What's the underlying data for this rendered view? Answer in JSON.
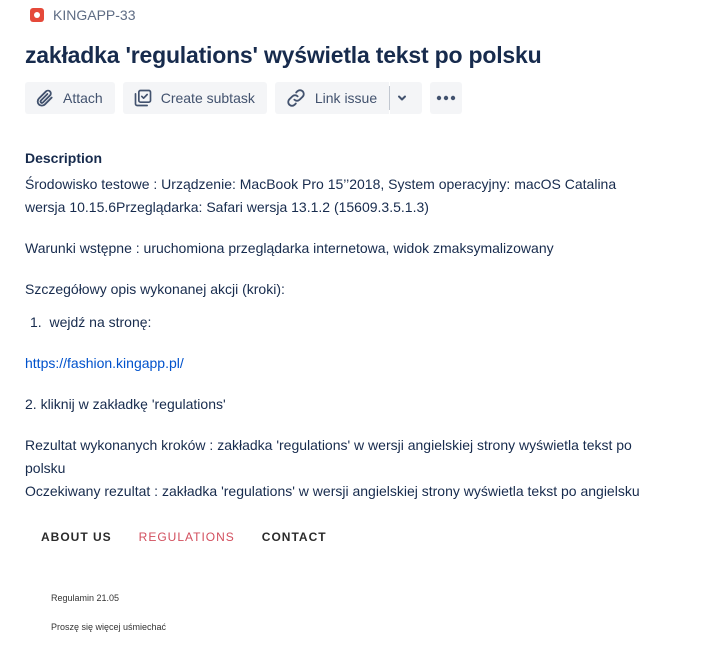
{
  "issue": {
    "key": "KINGAPP-33",
    "title": "zakładka 'regulations' wyświetla tekst po polsku"
  },
  "toolbar": {
    "attach_label": "Attach",
    "create_subtask_label": "Create subtask",
    "link_issue_label": "Link issue"
  },
  "description": {
    "heading": "Description",
    "environment_line1": "Środowisko testowe : Urządzenie: MacBook Pro 15’’2018, System operacyjny: macOS Catalina",
    "environment_line2": "wersja 10.15.6Przeglądarka: Safari wersja 13.1.2 (15609.3.5.1.3)",
    "preconditions": "Warunki wstępne : uruchomiona przeglądarka internetowa, widok zmaksymalizowany",
    "steps_heading": "Szczegółowy opis wykonanej akcji (kroki):",
    "step1_number": "1.",
    "step1_text": "wejdź na stronę:",
    "link": "https://fashion.kingapp.pl/",
    "step2": "2. kliknij w zakładkę 'regulations'",
    "result_line1": "Rezultat wykonanych kroków : zakładka 'regulations' w wersji angielskiej strony wyświetla tekst po",
    "result_line2": "polsku",
    "expected": "Oczekiwany rezultat : zakładka 'regulations' w wersji angielskiej strony wyświetla tekst po angielsku"
  },
  "screenshot": {
    "nav": [
      "ABOUT US",
      "REGULATIONS",
      "CONTACT"
    ],
    "line1": "Regulamin 21.05",
    "line2": "Proszę się więcej uśmiechać"
  },
  "colors": {
    "bug_icon": "#e5493a",
    "link": "#0052cc",
    "active_nav": "#d24f5e"
  }
}
